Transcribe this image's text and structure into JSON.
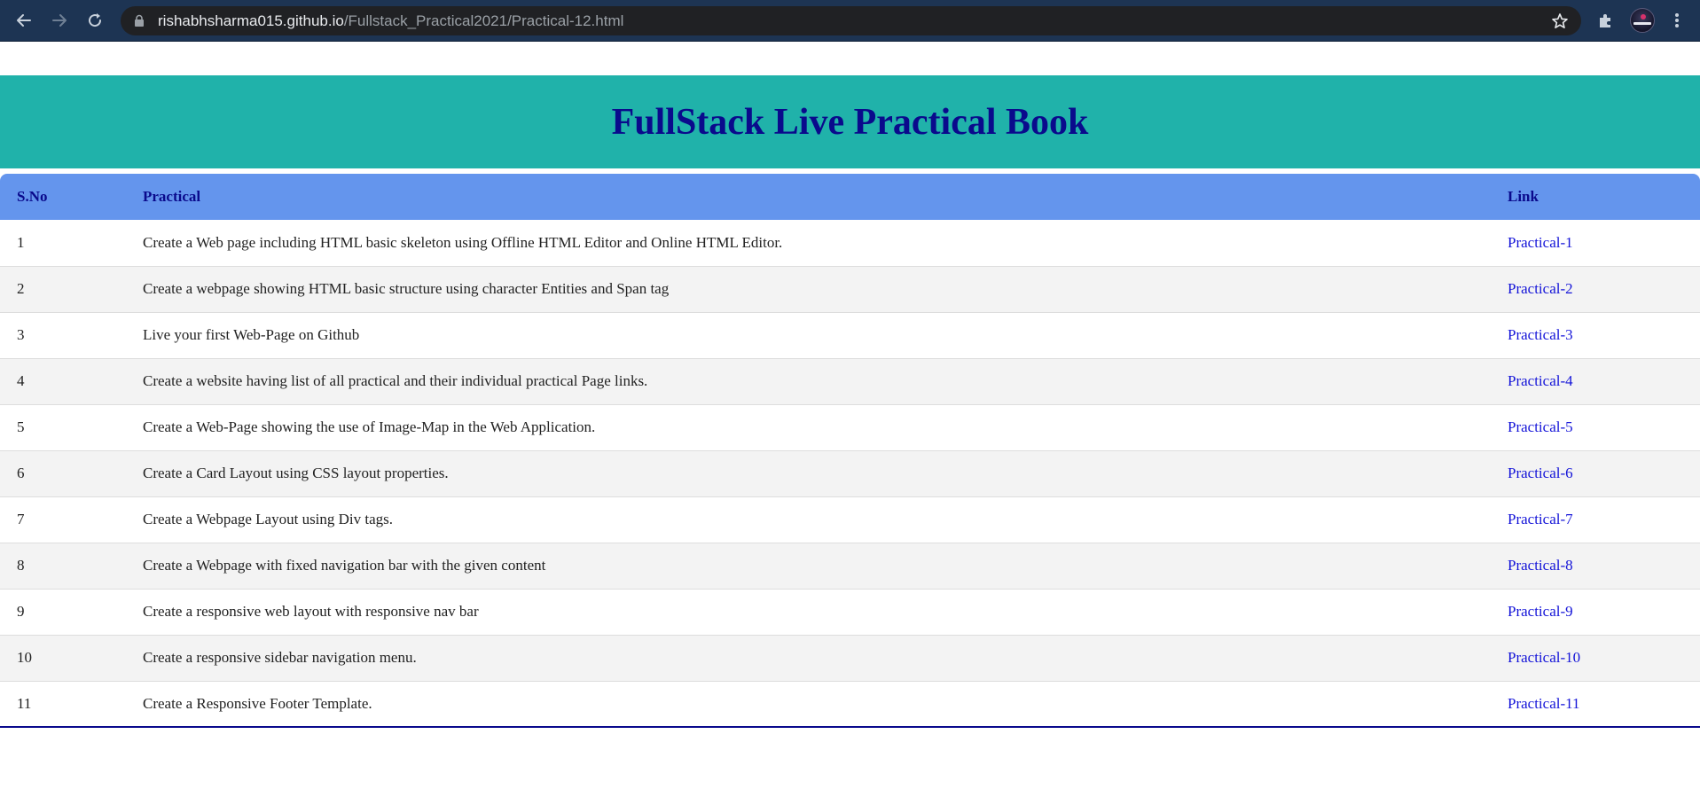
{
  "browser": {
    "url_host": "rishabhsharma015.github.io",
    "url_path": "/Fullstack_Practical2021/Practical-12.html",
    "icons": [
      "back-icon",
      "forward-icon",
      "reload-icon",
      "lock-icon",
      "star-icon",
      "extensions-icon",
      "avatar",
      "menu-icon"
    ]
  },
  "page": {
    "title": "FullStack Live Practical Book",
    "colors": {
      "banner_bg": "#20b2aa",
      "title": "#0a0a8c",
      "header_bg": "#6495ed",
      "link": "#1414d8"
    }
  },
  "table": {
    "headers": [
      "S.No",
      "Practical",
      "Link"
    ],
    "rows": [
      {
        "sno": "1",
        "practical": "Create a Web page including HTML basic skeleton using Offline HTML Editor and Online HTML Editor.",
        "link": "Practical-1"
      },
      {
        "sno": "2",
        "practical": "Create a webpage showing HTML basic structure using character Entities and Span tag",
        "link": "Practical-2"
      },
      {
        "sno": "3",
        "practical": "Live your first Web-Page on Github",
        "link": "Practical-3"
      },
      {
        "sno": "4",
        "practical": "Create a website having list of all practical and their individual practical Page links.",
        "link": "Practical-4"
      },
      {
        "sno": "5",
        "practical": "Create a Web-Page showing the use of Image-Map in the Web Application.",
        "link": "Practical-5"
      },
      {
        "sno": "6",
        "practical": "Create a Card Layout using CSS layout properties.",
        "link": "Practical-6"
      },
      {
        "sno": "7",
        "practical": "Create a Webpage Layout using Div tags.",
        "link": "Practical-7"
      },
      {
        "sno": "8",
        "practical": "Create a Webpage with fixed navigation bar with the given content",
        "link": "Practical-8"
      },
      {
        "sno": "9",
        "practical": "Create a responsive web layout with responsive nav bar",
        "link": "Practical-9"
      },
      {
        "sno": "10",
        "practical": "Create a responsive sidebar navigation menu.",
        "link": "Practical-10"
      },
      {
        "sno": "11",
        "practical": "Create a Responsive Footer Template.",
        "link": "Practical-11"
      }
    ]
  }
}
